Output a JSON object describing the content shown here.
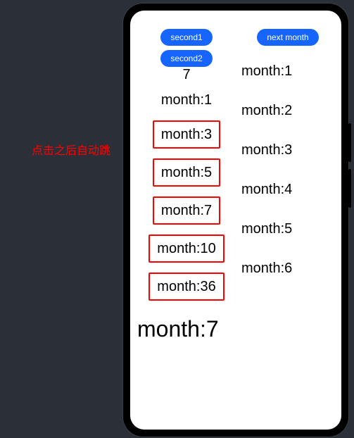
{
  "annotation": "点击之后自动跳",
  "left_col": {
    "buttons": [
      "second1",
      "second2"
    ],
    "header_number": "7",
    "items": [
      {
        "label": "month:1",
        "boxed": false
      },
      {
        "label": "month:3",
        "boxed": true
      },
      {
        "label": "month:5",
        "boxed": true
      },
      {
        "label": "month:7",
        "boxed": true
      },
      {
        "label": "month:10",
        "boxed": true
      },
      {
        "label": "month:36",
        "boxed": true
      }
    ],
    "big_item": "month:7"
  },
  "right_col": {
    "button": "next month",
    "items": [
      "month:1",
      "month:2",
      "month:3",
      "month:4",
      "month:5",
      "month:6"
    ]
  }
}
